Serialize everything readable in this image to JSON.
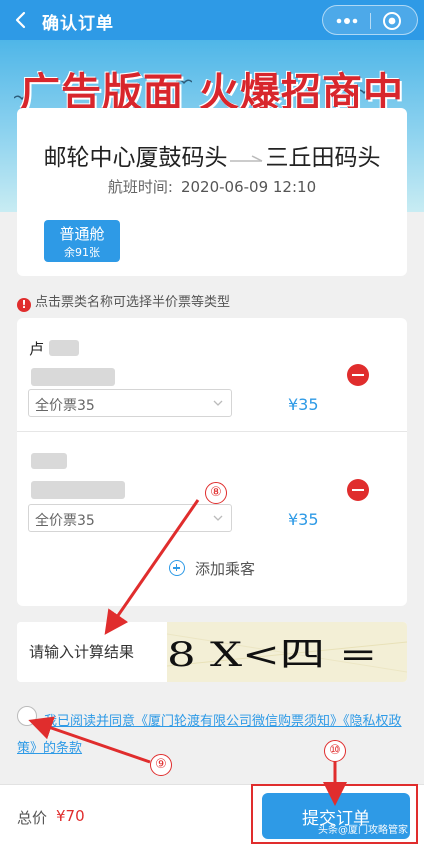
{
  "header": {
    "title": "确认订单",
    "back_icon": "back-chevron-icon",
    "more_icon": "more-dots-icon",
    "close_icon": "target-circle-icon"
  },
  "banner": {
    "text": "广告版面  火爆招商中"
  },
  "trip": {
    "from": "邮轮中心厦鼓码头",
    "to": "三丘田码头",
    "schedule_label": "航班时间:",
    "schedule_value": "2020-06-09 12:10"
  },
  "cabin": {
    "name": "普通舱",
    "remaining": "余91张"
  },
  "notice": "点击票类名称可选择半价票等类型",
  "passengers": [
    {
      "name": "卢",
      "ticket_type": "全价票35",
      "price": "¥35"
    },
    {
      "name": "",
      "ticket_type": "全价票35",
      "price": "¥35"
    }
  ],
  "add_passenger_label": "添加乘客",
  "captcha": {
    "placeholder": "请输入计算结果",
    "expression": "8 X<四 ="
  },
  "agreement": {
    "prefix": "我已阅读并同意",
    "link1": "《厦门轮渡有限公司微信购票须知》",
    "link2": "《隐私权政策》",
    "suffix": "的条款"
  },
  "footer": {
    "total_label": "总价",
    "total_value": "¥70",
    "submit_label": "提交订单",
    "watermark": "头条@厦门攻略管家"
  },
  "annotations": {
    "step8": "⑧",
    "step9": "⑨",
    "step10": "⑩"
  },
  "colors": {
    "primary": "#2e9ae6",
    "danger": "#e02d2d",
    "banner_text": "#d8262c"
  }
}
